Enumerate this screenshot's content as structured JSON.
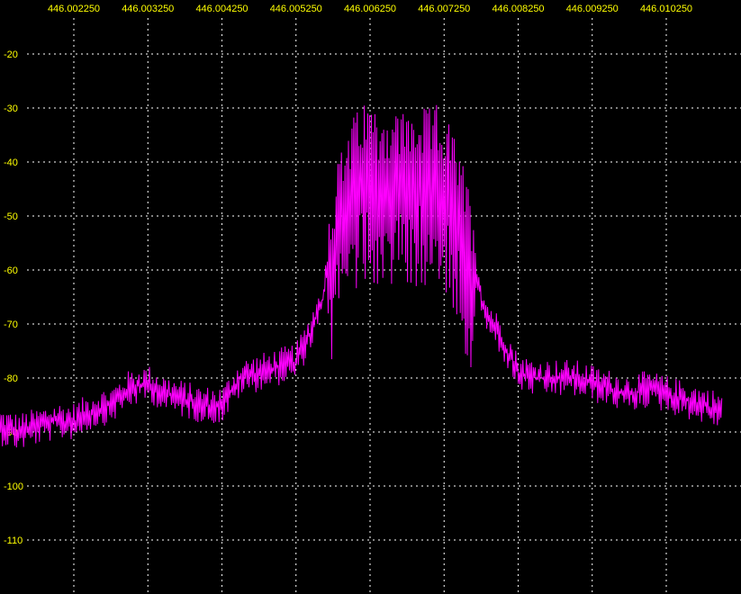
{
  "chart_data": {
    "type": "line",
    "title": "",
    "xlabel": "",
    "ylabel": "",
    "x_tick_labels": [
      "446.002250",
      "446.003250",
      "446.004250",
      "446.005250",
      "446.006250",
      "446.007250",
      "446.008250",
      "446.009250",
      "446.010250"
    ],
    "y_tick_labels": [
      "-20",
      "-30",
      "-40",
      "-50",
      "-60",
      "-70",
      "-80",
      "-90",
      "-100",
      "-110"
    ],
    "xlim": [
      446.00125,
      446.01125
    ],
    "ylim": [
      -120,
      -10
    ],
    "grid": true,
    "series": [
      {
        "color": "#ff00ff",
        "x": [
          446.00125,
          446.0015,
          446.00175,
          446.002,
          446.00225,
          446.0025,
          446.00275,
          446.003,
          446.00325,
          446.0035,
          446.00375,
          446.004,
          446.00425,
          446.0045,
          446.00475,
          446.005,
          446.00525,
          446.0054,
          446.0056,
          446.0058,
          446.006,
          446.0062,
          446.0064,
          446.0066,
          446.0068,
          446.007,
          446.0072,
          446.0074,
          446.0076,
          446.0078,
          446.008,
          446.00825,
          446.0085,
          446.00875,
          446.009,
          446.00925,
          446.0095,
          446.00975,
          446.01,
          446.01025,
          446.0105,
          446.01075,
          446.011
        ],
        "y": [
          -89,
          -90,
          -89,
          -88,
          -88,
          -86,
          -85,
          -82,
          -81,
          -83,
          -84,
          -85,
          -85,
          -80,
          -79,
          -78,
          -77,
          -73,
          -66,
          -50,
          -42,
          -38,
          -40,
          -40,
          -40,
          -40,
          -39,
          -45,
          -55,
          -68,
          -72,
          -79,
          -80,
          -80,
          -80,
          -81,
          -82,
          -83,
          -82,
          -83,
          -84,
          -85,
          -86
        ]
      }
    ]
  }
}
